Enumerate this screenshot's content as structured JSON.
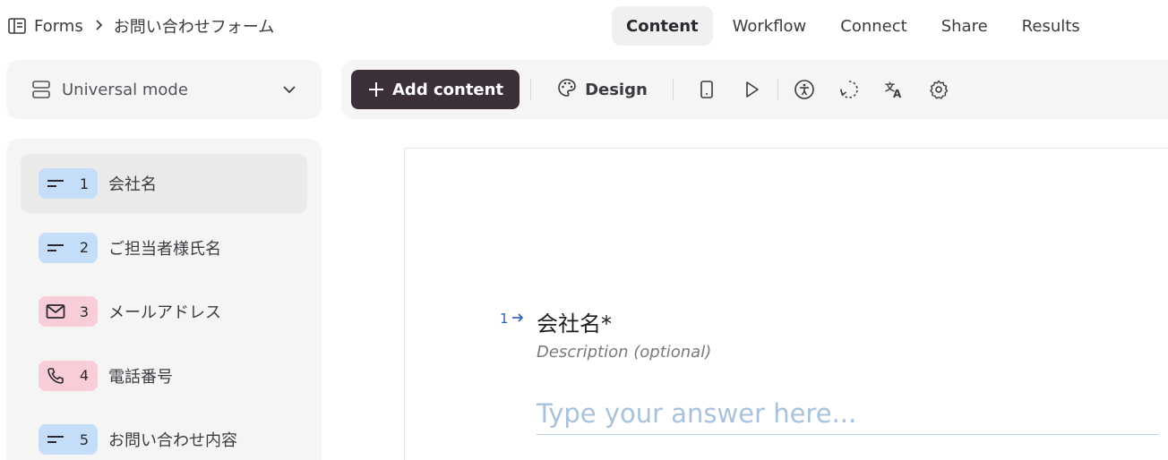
{
  "breadcrumb": {
    "root": "Forms",
    "current": "お問い合わせフォーム"
  },
  "tabs": [
    {
      "label": "Content",
      "active": true
    },
    {
      "label": "Workflow",
      "active": false
    },
    {
      "label": "Connect",
      "active": false
    },
    {
      "label": "Share",
      "active": false
    },
    {
      "label": "Results",
      "active": false
    }
  ],
  "mode": {
    "label": "Universal mode"
  },
  "toolbar": {
    "add_label": "Add content",
    "design_label": "Design",
    "icons": [
      "mobile-preview-icon",
      "play-icon",
      "accessibility-icon",
      "logic-icon",
      "translate-icon",
      "settings-icon"
    ]
  },
  "questions": [
    {
      "number": "1",
      "title": "会社名",
      "type": "short-text",
      "color": "blue",
      "selected": true
    },
    {
      "number": "2",
      "title": "ご担当者様氏名",
      "type": "short-text",
      "color": "blue",
      "selected": false
    },
    {
      "number": "3",
      "title": "メールアドレス",
      "type": "email",
      "color": "pink",
      "selected": false
    },
    {
      "number": "4",
      "title": "電話番号",
      "type": "phone",
      "color": "pink",
      "selected": false
    },
    {
      "number": "5",
      "title": "お問い合わせ内容",
      "type": "short-text",
      "color": "blue",
      "selected": false
    }
  ],
  "editor": {
    "question_number": "1",
    "question_title": "会社名*",
    "description_placeholder": "Description (optional)",
    "answer_placeholder": "Type your answer here..."
  },
  "colors": {
    "add_button_bg": "#3b2f3a",
    "badge_blue": "#c4def9",
    "badge_pink": "#f8cdd8",
    "number_arrow": "#2b5fb6",
    "answer_placeholder": "#a9c2dc"
  }
}
